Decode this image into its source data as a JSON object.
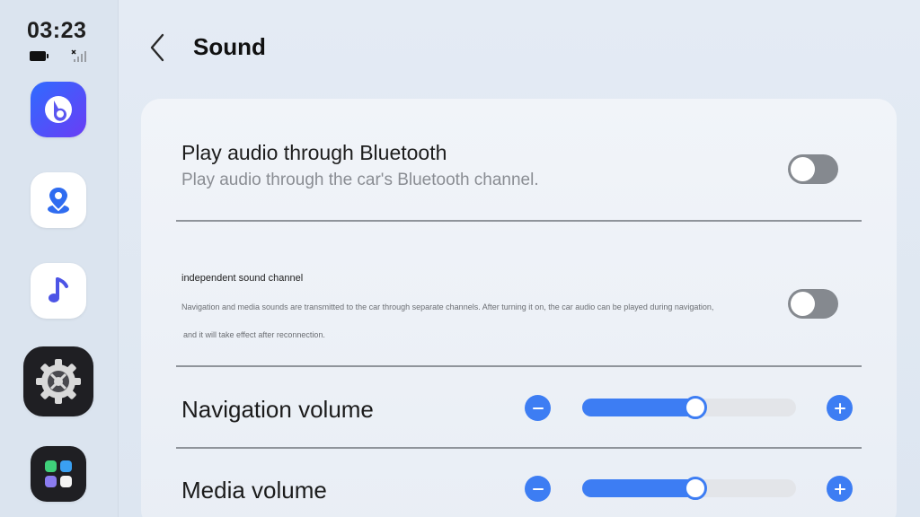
{
  "status": {
    "time": "03:23"
  },
  "dock": {
    "apps": [
      {
        "name": "bixby-icon"
      },
      {
        "name": "map-pin-icon"
      },
      {
        "name": "music-note-icon"
      },
      {
        "name": "gear-icon"
      },
      {
        "name": "app-grid-icon"
      }
    ]
  },
  "header": {
    "title": "Sound"
  },
  "bluetooth_option": {
    "title": "Play audio through Bluetooth",
    "description": "Play audio through the car's Bluetooth channel.",
    "enabled": false
  },
  "independent_channel_option": {
    "title": "independent sound channel",
    "description_line1": "Navigation and media sounds are transmitted to the car through separate channels. After turning it on, the car audio can be played during navigation,",
    "description_line2": "and it will take effect after reconnection.",
    "enabled": false
  },
  "navigation_volume": {
    "label": "Navigation volume",
    "level_percent": 53
  },
  "media_volume": {
    "label": "Media volume",
    "level_percent": 53
  },
  "colors": {
    "accent": "#3d7df3",
    "toggle_off": "#85898f",
    "background": "#e4ebf4"
  }
}
